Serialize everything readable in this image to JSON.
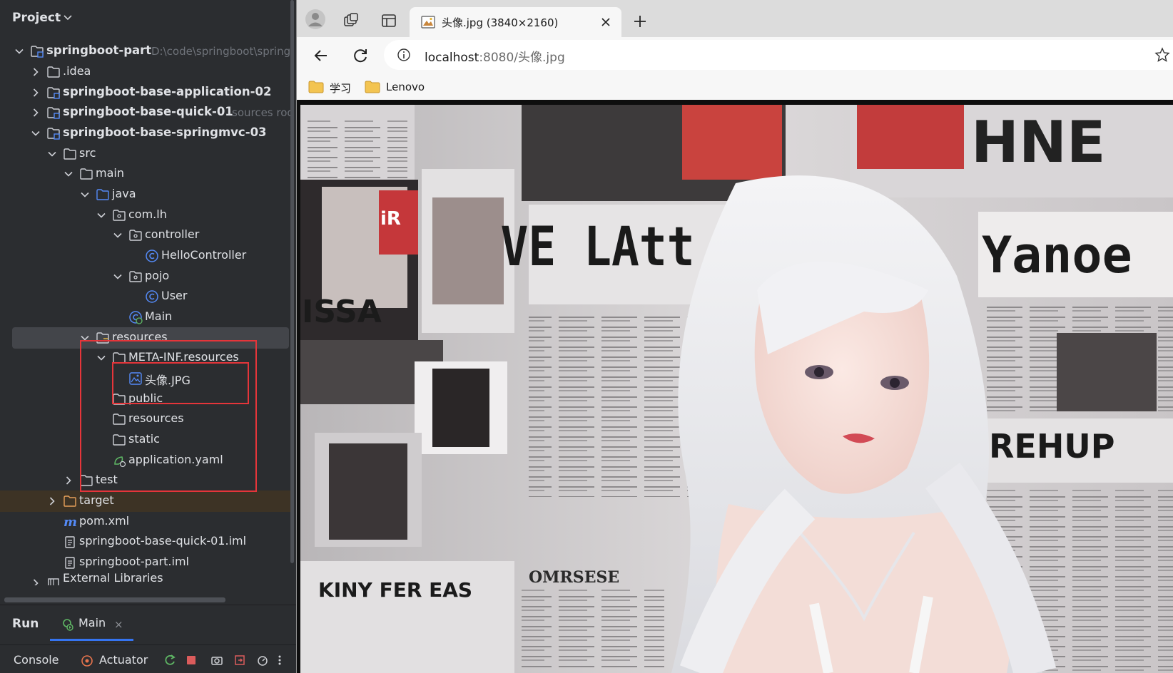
{
  "ide": {
    "project_title": "Project",
    "tree": [
      {
        "label": "springboot-part",
        "hint": "D:\\code\\springboot\\spring",
        "bold": true
      },
      {
        "label": ".idea"
      },
      {
        "label": "springboot-base-application-02",
        "bold": true
      },
      {
        "label": "springboot-base-quick-01",
        "hint": "sources roo",
        "bold": true
      },
      {
        "label": "springboot-base-springmvc-03",
        "bold": true
      },
      {
        "label": "src"
      },
      {
        "label": "main"
      },
      {
        "label": "java"
      },
      {
        "label": "com.lh"
      },
      {
        "label": "controller"
      },
      {
        "label": "HelloController"
      },
      {
        "label": "pojo"
      },
      {
        "label": "User"
      },
      {
        "label": "Main"
      },
      {
        "label": "resources"
      },
      {
        "label": "META-INF.resources"
      },
      {
        "label": "头像.JPG"
      },
      {
        "label": "public"
      },
      {
        "label": "resources"
      },
      {
        "label": "static"
      },
      {
        "label": "application.yaml"
      },
      {
        "label": "test"
      },
      {
        "label": "target"
      },
      {
        "label": "pom.xml"
      },
      {
        "label": "springboot-base-quick-01.iml"
      },
      {
        "label": "springboot-part.iml"
      },
      {
        "label": "External Libraries"
      }
    ],
    "run": {
      "title": "Run",
      "tab_label": "Main",
      "close_glyph": "×",
      "console_label": "Console",
      "actuator_label": "Actuator"
    }
  },
  "browser": {
    "tab_title": "头像.jpg (3840×2160)",
    "url_host": "localhost",
    "url_rest": ":8080/头像.jpg",
    "bookmarks": [
      {
        "label": "学习"
      },
      {
        "label": "Lenovo"
      }
    ],
    "image_text": {
      "headline_1": "VE LAtt FAC",
      "headline_2": "Yanoe",
      "headline_3": "REHUP",
      "headline_4": "KINY FER EAS",
      "headline_5": "OMRSESE",
      "headline_6": "HNE",
      "headline_7": "ISSA",
      "headline_8": "iR"
    }
  }
}
